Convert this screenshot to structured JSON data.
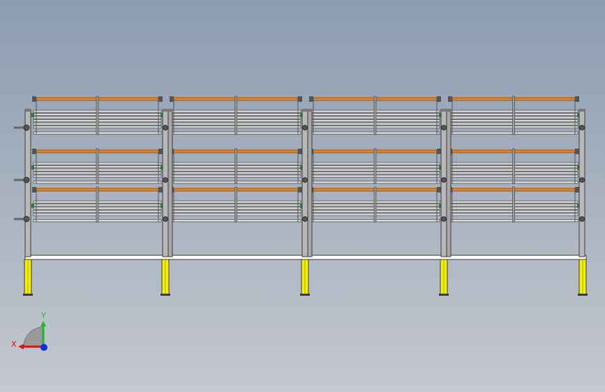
{
  "viewport": {
    "background_top": "#8c9cb1",
    "background_bottom": "#c4c8cf"
  },
  "model": {
    "bays": 4,
    "tiers": 3,
    "colors": {
      "frame_edge": "#3a3a3a",
      "frame_fill": "#b8b8b8",
      "roller_fill": "#d8d8d8",
      "orange_rail": "#e8821e",
      "leg_fill": "#f0f000",
      "base_fill": "#ffffff",
      "bracket_green": "#2e7d32"
    }
  },
  "triad": {
    "x_label": "X",
    "y_label": "Y",
    "x_color": "#e01010",
    "y_color": "#10c020",
    "z_color": "#1030e0"
  }
}
